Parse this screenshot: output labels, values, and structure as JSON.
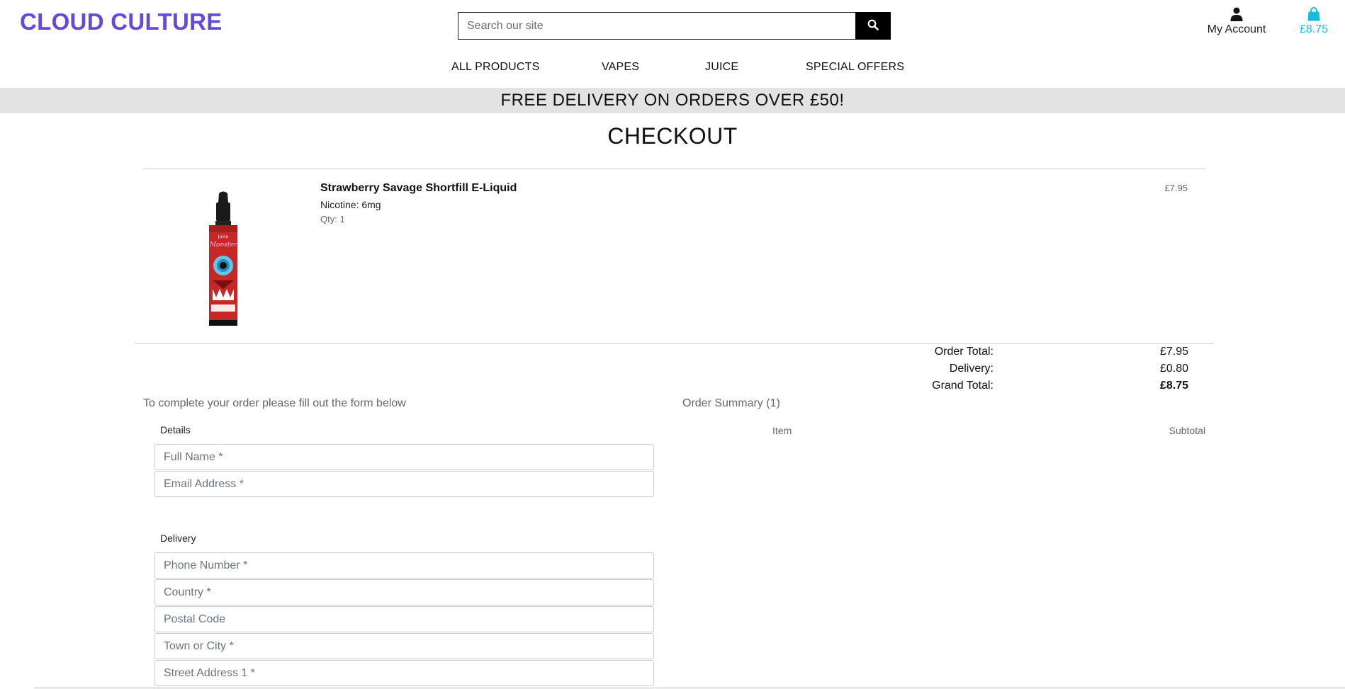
{
  "header": {
    "logo": "CLOUD CULTURE",
    "search_placeholder": "Search our site",
    "account_label": "My Account",
    "bag_total": "£8.75",
    "accent_color": "#6549d8",
    "bag_color": "#17bedc"
  },
  "nav": {
    "items": [
      "ALL PRODUCTS",
      "VAPES",
      "JUICE",
      "SPECIAL OFFERS"
    ]
  },
  "banner": "FREE DELIVERY ON ORDERS OVER £50!",
  "page_title": "CHECKOUT",
  "product": {
    "name": "Strawberry Savage Shortfill E-Liquid",
    "nicotine": "Nicotine: 6mg",
    "qty": "Qty: 1",
    "price": "£7.95",
    "image_icon": "e-liquid-bottle"
  },
  "totals": {
    "order_total_label": "Order Total:",
    "order_total": "£7.95",
    "delivery_label": "Delivery:",
    "delivery": "£0.80",
    "grand_total_label": "Grand Total:",
    "grand_total": "£8.75"
  },
  "form": {
    "intro": "To complete your order please fill out the form below",
    "details_legend": "Details",
    "full_name_placeholder": "Full Name *",
    "email_placeholder": "Email Address *",
    "delivery_legend": "Delivery",
    "phone_placeholder": "Phone Number *",
    "country_placeholder": "Country *",
    "postcode_placeholder": "Postal Code",
    "town_placeholder": "Town or City *",
    "street1_placeholder": "Street Address 1 *"
  },
  "summary": {
    "title": "Order Summary (1)",
    "item_header": "Item",
    "subtotal_header": "Subtotal"
  }
}
